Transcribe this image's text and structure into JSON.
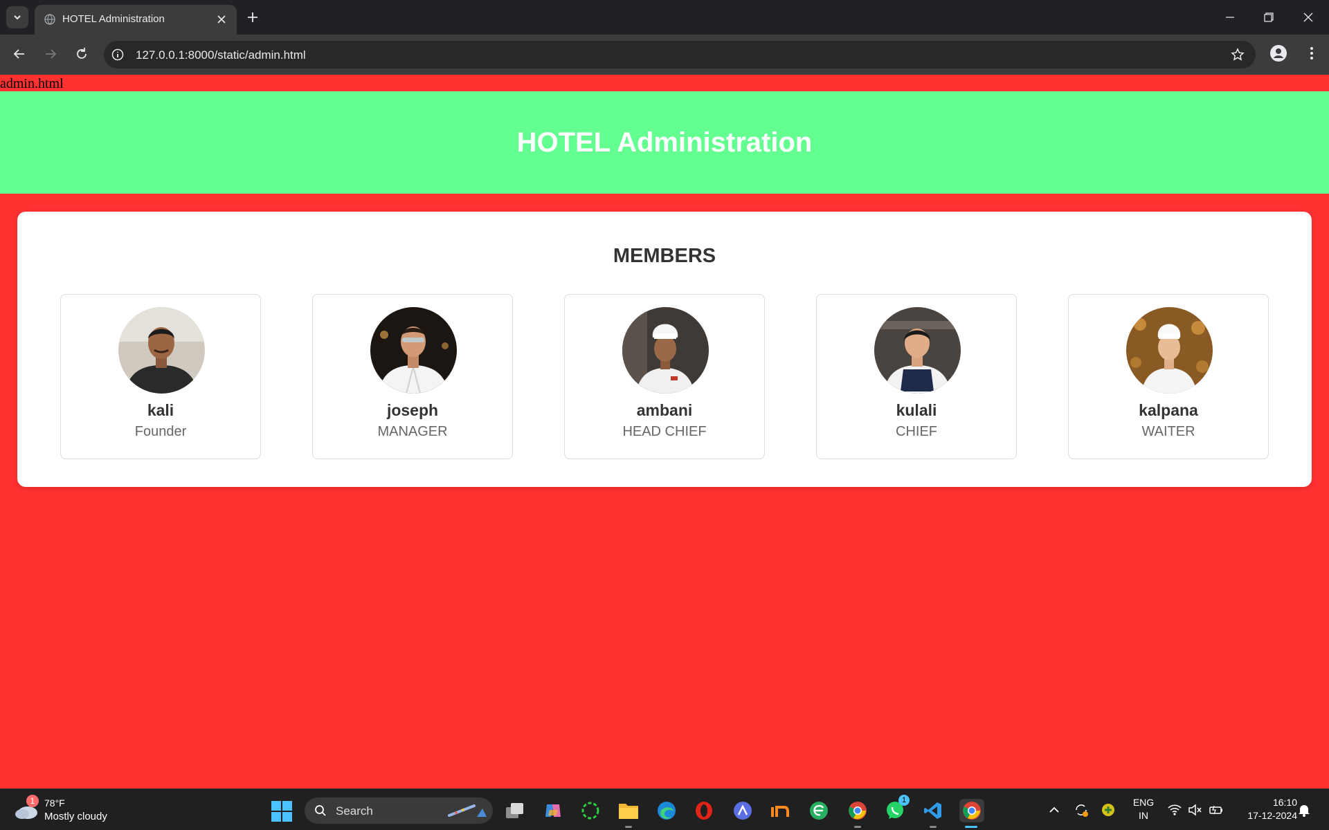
{
  "browser": {
    "tab_title": "HOTEL Administration",
    "url": "127.0.0.1:8000/static/admin.html"
  },
  "page": {
    "file_label": "admin.html",
    "header_title": "HOTEL Administration",
    "section_title": "MEMBERS",
    "members": [
      {
        "name": "kali",
        "role": "Founder"
      },
      {
        "name": "joseph",
        "role": "MANAGER"
      },
      {
        "name": "ambani",
        "role": "HEAD CHIEF"
      },
      {
        "name": "kulali",
        "role": "CHIEF"
      },
      {
        "name": "kalpana",
        "role": "WAITER"
      }
    ]
  },
  "taskbar": {
    "weather_badge": "1",
    "temperature": "78°F",
    "weather_condition": "Mostly cloudy",
    "search_label": "Search",
    "whatsapp_badge": "1",
    "language_line1": "ENG",
    "language_line2": "IN",
    "time": "16:10",
    "date": "17-12-2024"
  },
  "colors": {
    "page_background": "#ff3131",
    "header_background": "#64ff91",
    "card_background": "#ffffff",
    "taskbar_accent": "#4cc2ff"
  }
}
